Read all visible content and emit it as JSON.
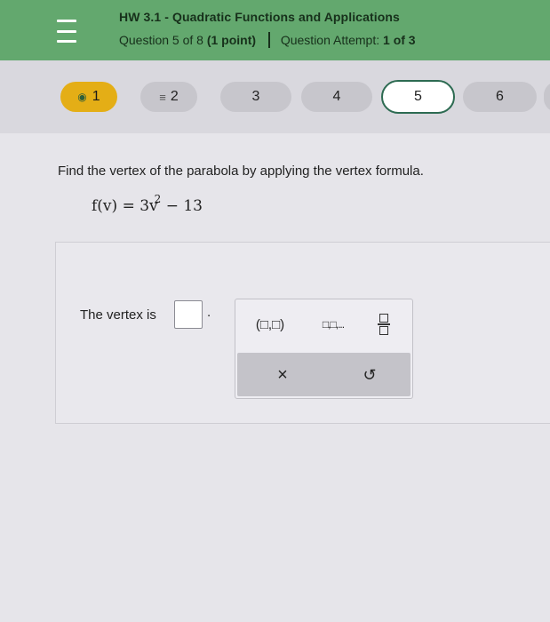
{
  "header": {
    "menu_icon": "hamburger-menu-icon",
    "title": "HW 3.1 - Quadratic Functions and Applications",
    "question_progress": "Question 5 of 8",
    "points": "(1 point)",
    "attempt_label": "Question Attempt:",
    "attempt_value": "1 of 3",
    "color": "#63a86e"
  },
  "question_nav": {
    "items": [
      {
        "label": "1",
        "status": "done",
        "icon": "partial-credit-icon",
        "color": "#e4ae16"
      },
      {
        "label": "2",
        "status": "in-progress",
        "icon": "equals-icon"
      },
      {
        "label": "3",
        "status": "unanswered"
      },
      {
        "label": "4",
        "status": "unanswered"
      },
      {
        "label": "5",
        "status": "current"
      },
      {
        "label": "6",
        "status": "unanswered"
      }
    ]
  },
  "question": {
    "prompt": "Find the vertex of the parabola by applying the vertex formula.",
    "formula_base": "f(v) = 3v",
    "formula_exp": "2",
    "formula_tail": "− 13"
  },
  "answer": {
    "label": "The vertex is",
    "value": "",
    "suffix": "."
  },
  "palette": {
    "ordered_pair": "(□,□)",
    "list": "□,□,...",
    "fraction_icon": "fraction-template-icon",
    "clear": "×",
    "undo": "↺"
  }
}
